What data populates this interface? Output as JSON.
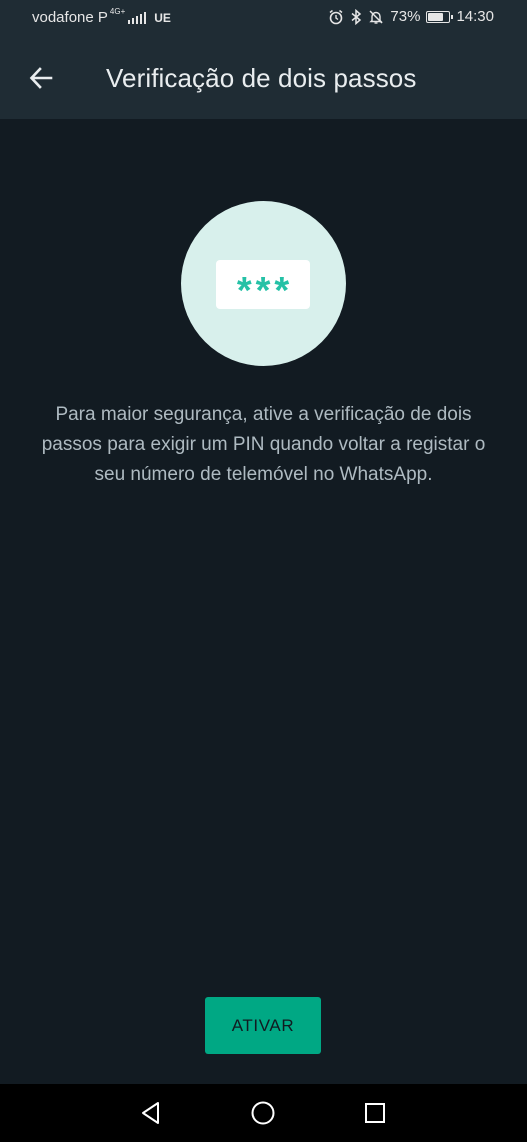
{
  "status_bar": {
    "carrier": "vodafone P",
    "network_type": "4G",
    "network_sub": "+",
    "carrier2": "UE",
    "battery_percent": "73%",
    "battery_level": 0.73,
    "time": "14:30",
    "icons": [
      "alarm-icon",
      "bluetooth-icon",
      "bell-off-icon",
      "battery-icon"
    ]
  },
  "app_bar": {
    "back_icon": "arrow-left-icon",
    "title": "Verificação de dois passos"
  },
  "illustration": {
    "pin_mask": "***"
  },
  "description": "Para maior segurança, ative a verificação de dois passos para exigir um PIN quando voltar a registar o seu número de telemóvel no WhatsApp.",
  "action_button": {
    "label": "ATIVAR"
  },
  "nav_bar": {
    "icons": [
      "back-triangle-icon",
      "home-circle-icon",
      "recents-square-icon"
    ]
  },
  "colors": {
    "background": "#121b22",
    "app_bar": "#1f2c34",
    "accent": "#00a884",
    "illustration_circle": "#d8f0ec",
    "pin_text": "#25c1a6"
  }
}
